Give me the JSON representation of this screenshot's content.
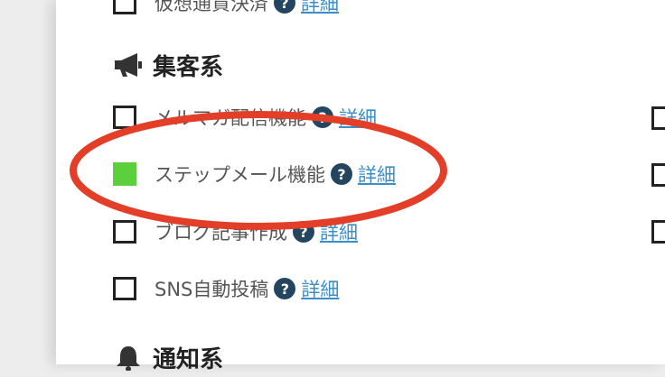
{
  "top_item": {
    "label": "仮想通貨決済",
    "link": "詳細",
    "checked": false
  },
  "section_marketing": {
    "title": "集客系",
    "icon": "megaphone-icon",
    "items": [
      {
        "label": "メルマガ配信機能",
        "link": "詳細",
        "checked": false
      },
      {
        "label": "ステップメール機能",
        "link": "詳細",
        "checked": true
      },
      {
        "label": "ブログ記事作成",
        "link": "詳細",
        "checked": false
      },
      {
        "label": "SNS自動投稿",
        "link": "詳細",
        "checked": false
      }
    ]
  },
  "section_notification": {
    "title": "通知系",
    "icon": "bell-icon"
  },
  "help_glyph": "?",
  "colors": {
    "checked": "#5ccf3c",
    "highlight_ellipse": "#e23e28",
    "link": "#3a8ec9",
    "help_icon": "#24455f"
  }
}
